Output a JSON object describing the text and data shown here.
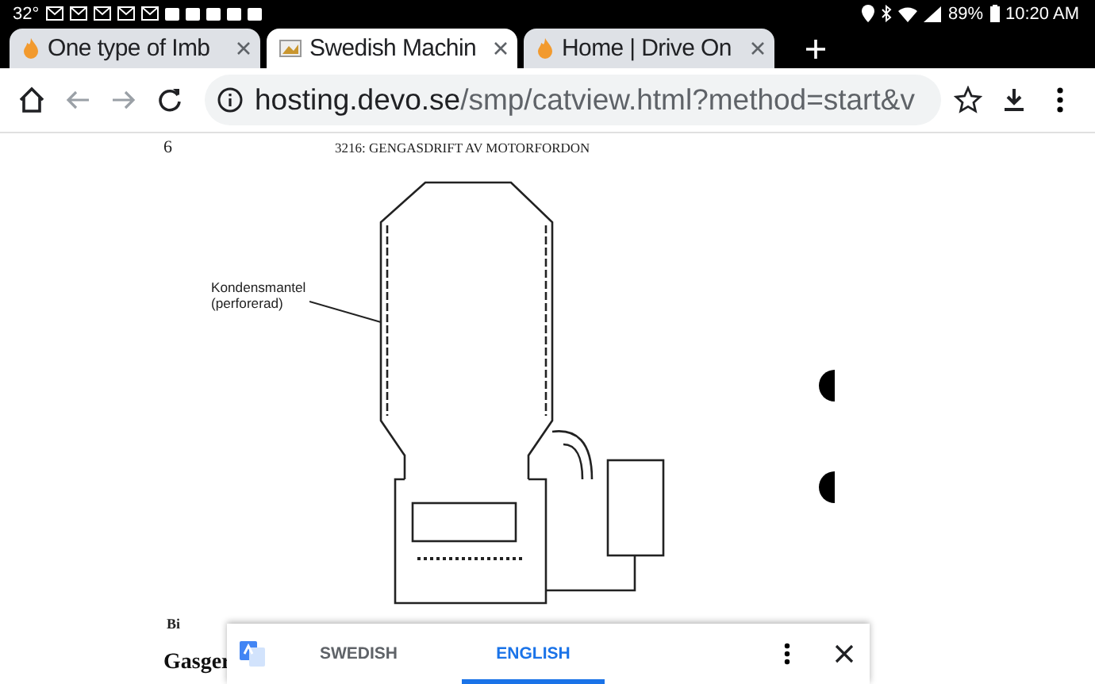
{
  "status_bar": {
    "temperature": "32°",
    "battery": "89%",
    "time": "10:20 AM"
  },
  "tabs": [
    {
      "title": "One type of Imb",
      "selected": false,
      "kind": "flame"
    },
    {
      "title": "Swedish Machin",
      "selected": true,
      "kind": "image"
    },
    {
      "title": "Home | Drive On",
      "selected": false,
      "kind": "flame"
    }
  ],
  "address_bar": {
    "host": "hosting.devo.se",
    "path": "/smp/catview.html?method=start&v"
  },
  "page": {
    "number": "6",
    "header": "3216: GENGASDRIFT AV MOTORFORDON",
    "label_lines": [
      "Kondensmantel",
      "(perforerad)"
    ],
    "caption": "Bi",
    "heading": "Gasger"
  },
  "translate_bar": {
    "languages": [
      {
        "label": "SWEDISH",
        "selected": false
      },
      {
        "label": "ENGLISH",
        "selected": true
      }
    ]
  }
}
